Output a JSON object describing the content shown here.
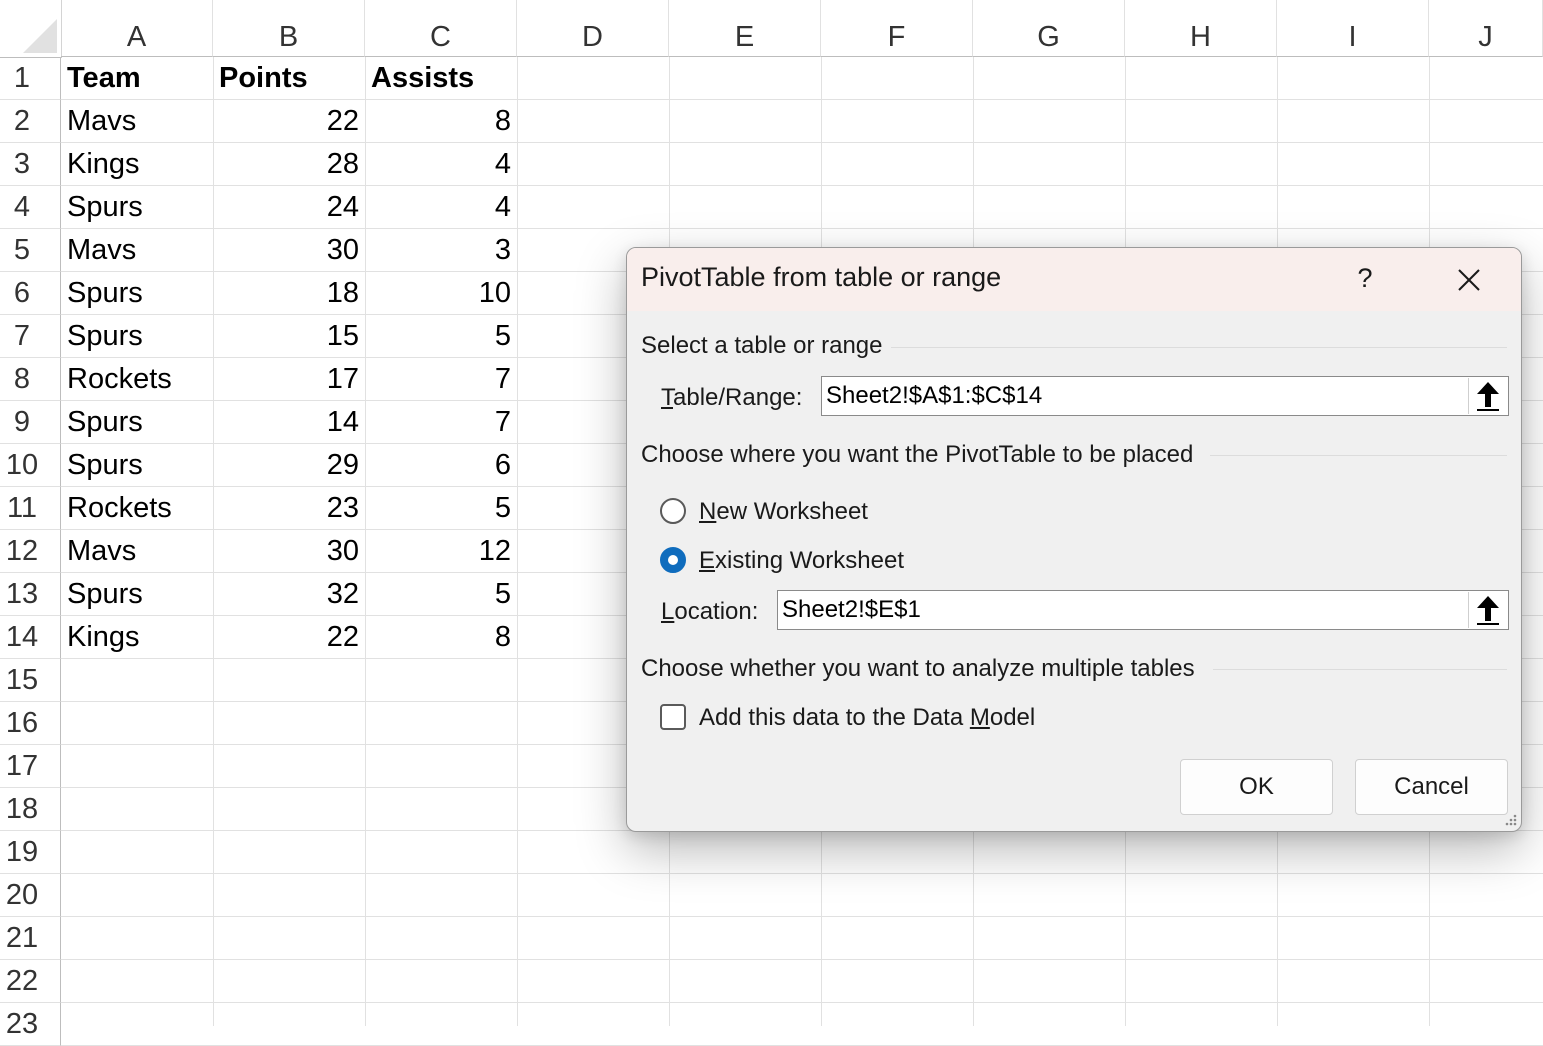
{
  "sheet": {
    "columns": [
      "A",
      "B",
      "C",
      "D",
      "E",
      "F",
      "G",
      "H",
      "I",
      "J"
    ],
    "rows": [
      "1",
      "2",
      "3",
      "4",
      "5",
      "6",
      "7",
      "8",
      "9",
      "10",
      "11",
      "12",
      "13",
      "14",
      "15",
      "16",
      "17",
      "18",
      "19",
      "20",
      "21",
      "22",
      "23"
    ],
    "headers": {
      "team": "Team",
      "points": "Points",
      "assists": "Assists"
    },
    "data": [
      {
        "team": "Mavs",
        "points": "22",
        "assists": "8"
      },
      {
        "team": "Kings",
        "points": "28",
        "assists": "4"
      },
      {
        "team": "Spurs",
        "points": "24",
        "assists": "4"
      },
      {
        "team": "Mavs",
        "points": "30",
        "assists": "3"
      },
      {
        "team": "Spurs",
        "points": "18",
        "assists": "10"
      },
      {
        "team": "Spurs",
        "points": "15",
        "assists": "5"
      },
      {
        "team": "Rockets",
        "points": "17",
        "assists": "7"
      },
      {
        "team": "Spurs",
        "points": "14",
        "assists": "7"
      },
      {
        "team": "Spurs",
        "points": "29",
        "assists": "6"
      },
      {
        "team": "Rockets",
        "points": "23",
        "assists": "5"
      },
      {
        "team": "Mavs",
        "points": "30",
        "assists": "12"
      },
      {
        "team": "Spurs",
        "points": "32",
        "assists": "5"
      },
      {
        "team": "Kings",
        "points": "22",
        "assists": "8"
      }
    ]
  },
  "dialog": {
    "title": "PivotTable from table or range",
    "help": "?",
    "section_select": "Select a table or range",
    "table_range_label_key": "T",
    "table_range_label_rest": "able/Range:",
    "table_range_value": "Sheet2!$A$1:$C$14",
    "section_place": "Choose where you want the PivotTable to be placed",
    "new_ws_key": "N",
    "new_ws_rest": "ew Worksheet",
    "existing_ws_key": "E",
    "existing_ws_rest": "xisting Worksheet",
    "selected_option": "existing",
    "location_label_key": "L",
    "location_label_rest": "ocation:",
    "location_value": "Sheet2!$E$1",
    "section_multi": "Choose whether you want to analyze multiple tables",
    "datamodel_pre": "Add this data to the Data ",
    "datamodel_key": "M",
    "datamodel_post": "odel",
    "datamodel_checked": false,
    "ok_label": "OK",
    "cancel_label": "Cancel"
  },
  "colors": {
    "accent": "#0f6cbd",
    "title_bar": "#f9eeec",
    "dialog_bg": "#f0f0f0"
  }
}
